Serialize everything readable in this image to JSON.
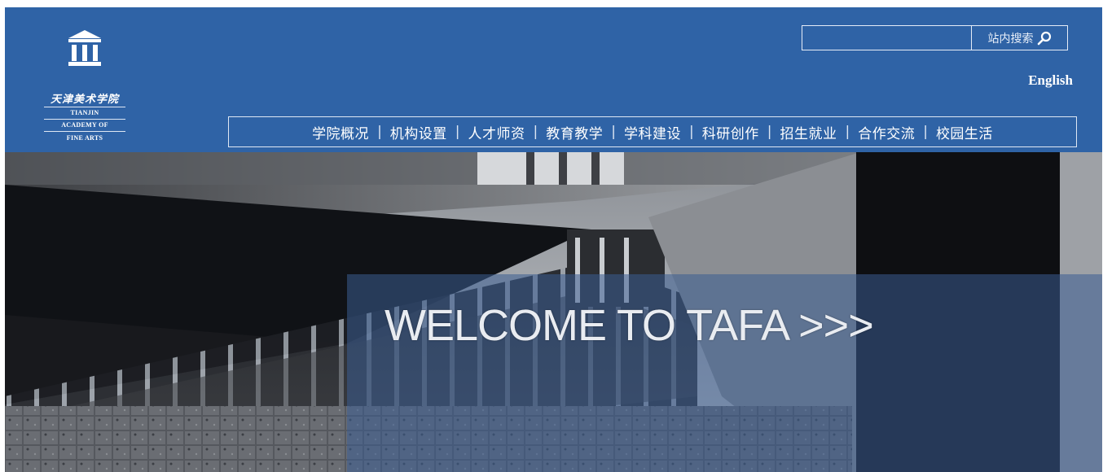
{
  "header": {
    "logo": {
      "cn": "天津美术学院",
      "en_line1": "TIANJIN",
      "en_line2": "ACADEMY OF",
      "en_line3": "FINE ARTS"
    },
    "search": {
      "value": "",
      "button_label": "站内搜索"
    },
    "language_link": "English",
    "nav": [
      "学院概况",
      "机构设置",
      "人才师资",
      "教育教学",
      "学科建设",
      "科研创作",
      "招生就业",
      "合作交流",
      "校园生活"
    ],
    "nav_separator": "|"
  },
  "hero": {
    "headline": "WELCOME TO TAFA >>>"
  },
  "colors": {
    "header_bg": "#2f63a6",
    "hero_overlay": "#3a5d92"
  },
  "icons": {
    "logo": "building-columns-icon",
    "search": "magnifier-icon"
  }
}
